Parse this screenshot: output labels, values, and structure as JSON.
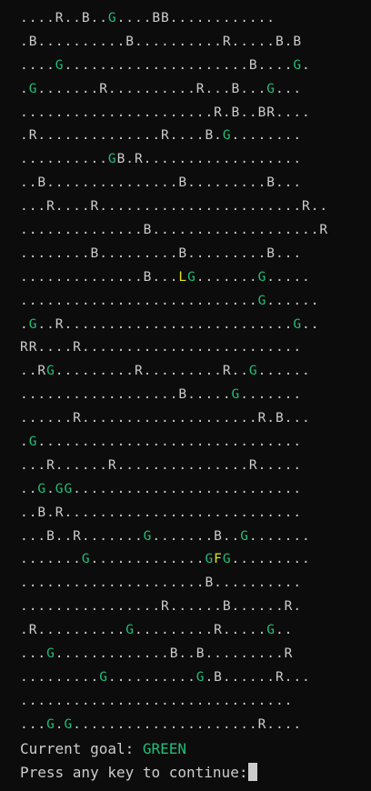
{
  "board": [
    "....R..B..G....BB............",
    ".B..........B..........R.....B.B",
    "....G.....................B....G.",
    ".G.......R..........R...B...G...",
    "......................R.B..BR....",
    ".R..............R....B.G........",
    "..........GB.R..................",
    "..B...............B.........B...",
    "...R....R.......................R..",
    "..............B...................R",
    "........B.........B.........B...",
    "..............B...LG.......G.....",
    "...........................G......",
    ".G..R..........................G..",
    "RR....R.........................",
    "..RG.........R.........R..G......",
    "..................B.....G.......",
    "......R....................R.B...",
    ".G..............................",
    "...R......R...............R.....",
    "..G.GG..........................",
    "..B.R...........................",
    "...B..R.......G.......B..G.......",
    ".......G.............GFG.........",
    ".....................B..........",
    "................R......B......R.",
    ".R..........G.........R.....G..",
    "...G.............B..B.........R",
    ".........G..........G.B......R...",
    "...............................",
    "...G.G.....................R...."
  ],
  "colors": {
    "G": "#1fbf7a",
    "L": "#e5e510",
    "F": "#e5e510",
    "default": "#cccccc",
    "background": "#0c0c0c"
  },
  "status": {
    "goal_label": "Current goal: ",
    "goal_value": "GREEN",
    "prompt": "Press any key to continue:"
  }
}
